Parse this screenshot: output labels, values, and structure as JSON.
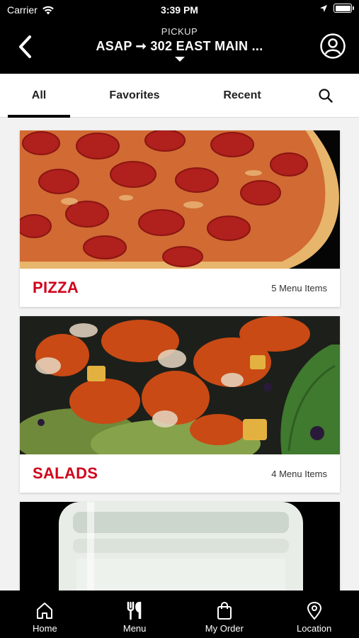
{
  "status_bar": {
    "carrier": "Carrier",
    "time": "3:39 PM"
  },
  "header": {
    "mode_label": "PICKUP",
    "route": "ASAP ➞ 302 EAST MAIN ..."
  },
  "tabs": [
    {
      "label": "All",
      "active": true
    },
    {
      "label": "Favorites",
      "active": false
    },
    {
      "label": "Recent",
      "active": false
    }
  ],
  "categories": [
    {
      "title": "PIZZA",
      "count": "5 Menu Items",
      "image": "pepperoni-pizza"
    },
    {
      "title": "SALADS",
      "count": "4 Menu Items",
      "image": "buffalo-chicken-salad"
    },
    {
      "title": "",
      "count": "",
      "image": "lemonade-jar"
    }
  ],
  "bottom_nav": [
    {
      "label": "Home",
      "icon": "home-icon"
    },
    {
      "label": "Menu",
      "icon": "utensils-icon"
    },
    {
      "label": "My Order",
      "icon": "bag-icon"
    },
    {
      "label": "Location",
      "icon": "location-icon"
    }
  ],
  "colors": {
    "accent": "#d0021b",
    "header_bg": "#000000",
    "page_bg": "#f2f2f2"
  }
}
